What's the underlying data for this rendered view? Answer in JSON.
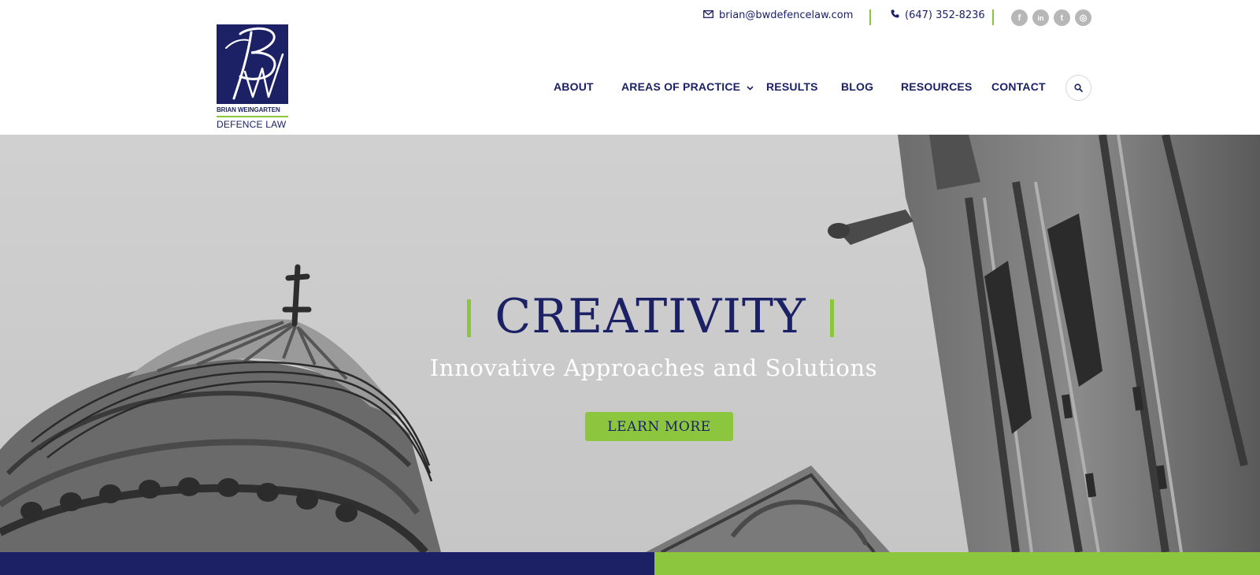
{
  "brand": {
    "name_line1": "BRIAN WEINGARTEN",
    "name_line2": "DEFENCE LAW",
    "monogram": "BW",
    "colors": {
      "navy": "#1c2166",
      "green": "#8cc63f"
    }
  },
  "topbar": {
    "email": "brian@bwdefencelaw.com",
    "phone": "(647) 352-8236",
    "social": [
      {
        "name": "facebook",
        "glyph": "f"
      },
      {
        "name": "linkedin",
        "glyph": "in"
      },
      {
        "name": "twitter",
        "glyph": "t"
      },
      {
        "name": "instagram",
        "glyph": "◎"
      }
    ]
  },
  "nav": {
    "items": [
      {
        "label": "ABOUT"
      },
      {
        "label": "AREAS OF PRACTICE",
        "has_dropdown": true
      },
      {
        "label": "RESULTS"
      },
      {
        "label": "BLOG"
      },
      {
        "label": "RESOURCES"
      },
      {
        "label": "CONTACT"
      }
    ],
    "search_icon": "search-icon"
  },
  "hero": {
    "headline": "CREATIVITY",
    "subheadline": "Innovative Approaches and Solutions",
    "cta_label": "LEARN MORE"
  }
}
